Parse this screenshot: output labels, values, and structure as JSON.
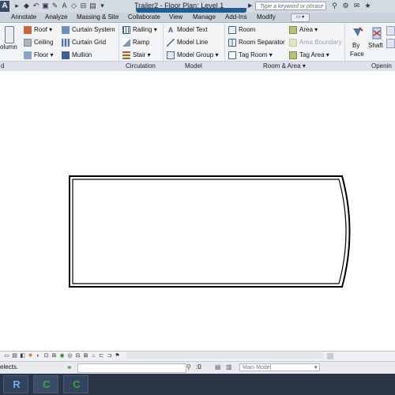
{
  "titlebar": {
    "app_logo": "A",
    "document_title": "Trailer2 - Floor Plan: Level 1",
    "search_placeholder": "Type a keyword or phrase"
  },
  "tabs": [
    "Annotate",
    "Analyze",
    "Massing & Site",
    "Collaborate",
    "View",
    "Manage",
    "Add-Ins",
    "Modify"
  ],
  "ribbon": {
    "build": {
      "column_label": "olumn",
      "roof_label": "Roof",
      "ceiling_label": "Ceiling",
      "floor_label": "Floor",
      "curtain_system_label": "Curtain System",
      "curtain_grid_label": "Curtain Grid",
      "mullion_label": "Mullion"
    },
    "circulation": {
      "railing_label": "Railing",
      "ramp_label": "Ramp",
      "stair_label": "Stair"
    },
    "model": {
      "model_text_label": "Model Text",
      "model_line_label": "Model Line",
      "model_group_label": "Model Group"
    },
    "room_area": {
      "room_label": "Room",
      "room_separator_label": "Room Separator",
      "tag_room_label": "Tag Room",
      "area_label": "Area",
      "area_boundary_label": "Area Boundary",
      "tag_area_label": "Tag Area"
    },
    "opening": {
      "by_label": "By",
      "face_label": "Face",
      "shaft_label": "Shaft"
    },
    "panels": {
      "build_panel": "d",
      "circulation_panel": "Circulation",
      "model_panel": "Model",
      "room_area_panel": "Room & Area",
      "opening_panel": "Openin"
    }
  },
  "statusbar": {
    "status_text": "elects.",
    "workset_value": ":0",
    "model_selector": "Main Model"
  },
  "colors": {
    "accent_blue": "#1f5e93",
    "taskbar": "#2a3548",
    "camtasia_green": "#3aa63a"
  }
}
